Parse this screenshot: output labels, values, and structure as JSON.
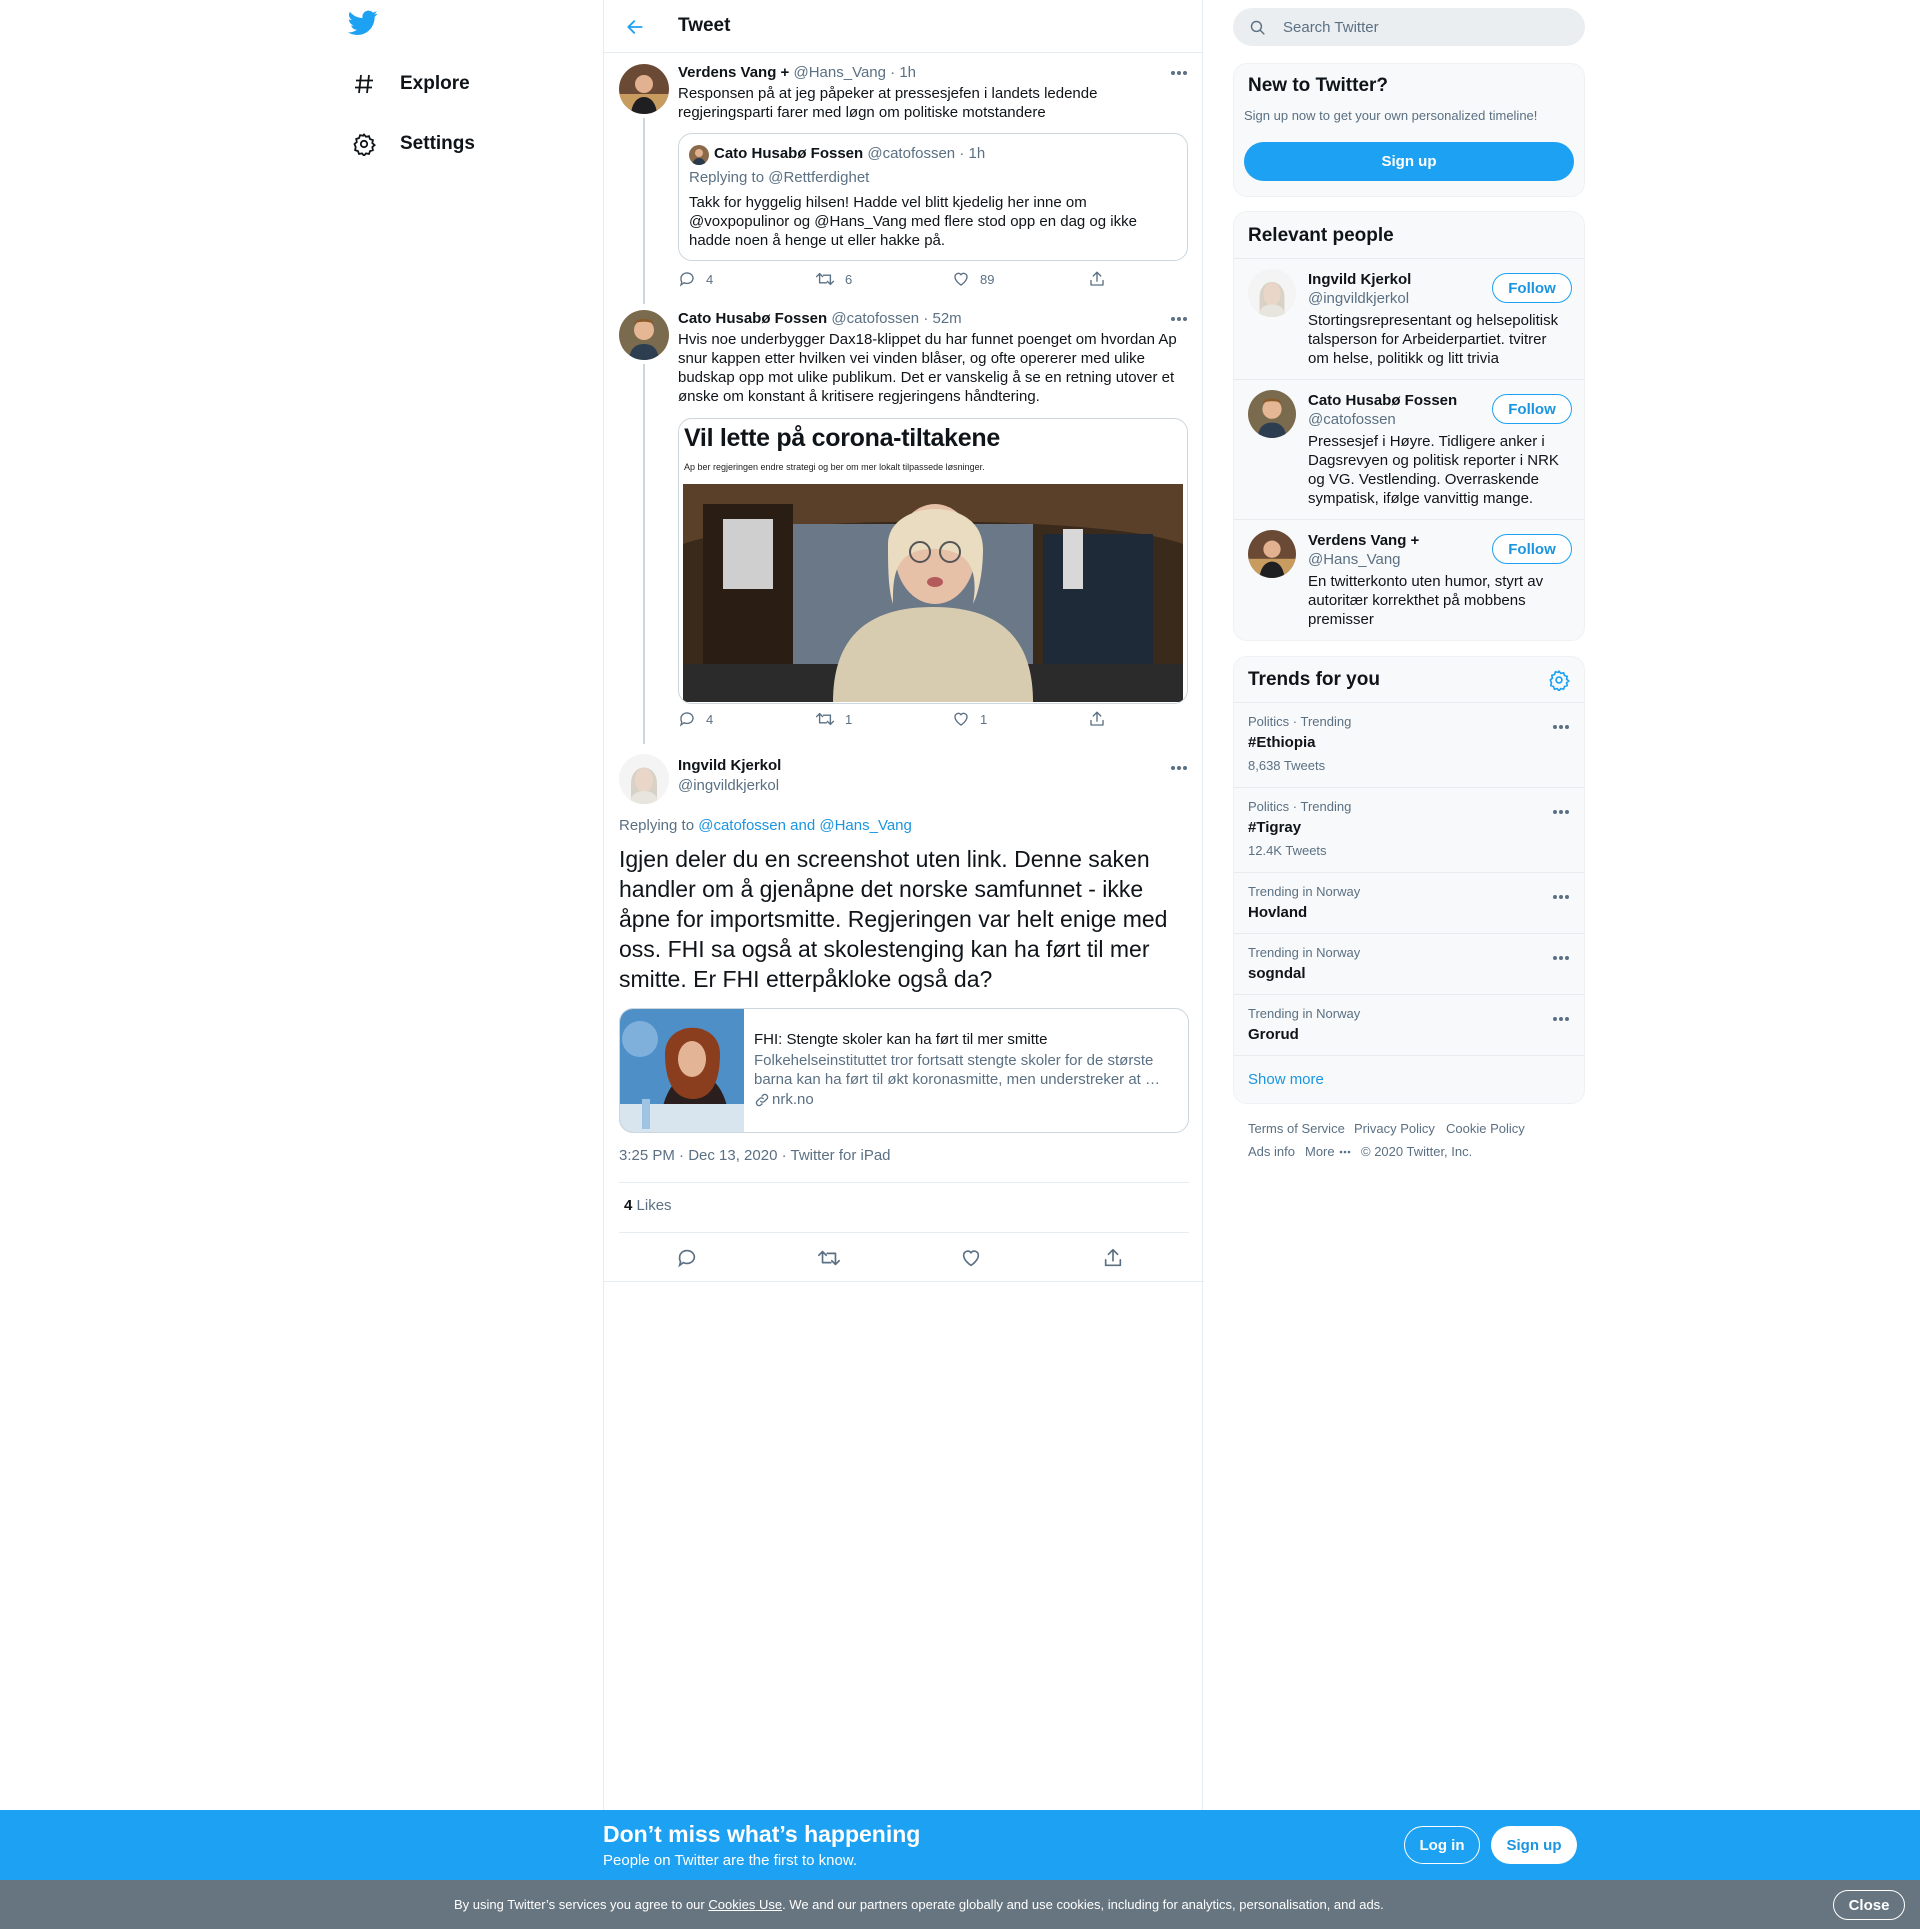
{
  "nav": {
    "logo": "twitter-bird-icon",
    "items": [
      {
        "label": "Explore",
        "icon": "hashtag-icon"
      },
      {
        "label": "Settings",
        "icon": "gear-icon"
      }
    ]
  },
  "header": {
    "title": "Tweet"
  },
  "tweets": [
    {
      "name": "Verdens Vang +",
      "handle": "@Hans_Vang",
      "time": "· 1h",
      "text": "Responsen på at jeg påpeker at pressesjefen i landets ledende regjeringsparti farer med løgn om politiske motstandere",
      "quote": {
        "name": "Cato Husabø Fossen",
        "handle": "@catofossen",
        "time": "· 1h",
        "replying": "Replying to @Rettferdighet",
        "text": "Takk for hyggelig hilsen! Hadde vel blitt kjedelig her inne om @voxpopulinor og @Hans_Vang med flere stod opp en dag og ikke hadde noen å henge ut eller hakke på."
      },
      "replies": "4",
      "retweets": "6",
      "likes": "89"
    },
    {
      "name": "Cato Husabø Fossen",
      "handle": "@catofossen",
      "time": "· 52m",
      "text": "Hvis noe underbygger Dax18-klippet du har funnet poenget om hvordan Ap snur kappen etter hvilken vei vinden blåser, og ofte opererer med ulike budskap opp mot ulike publikum. Det er vanskelig å se en retning utover et ønske om konstant å kritisere regjeringens håndtering.",
      "image": {
        "headline": "Vil lette på corona-tiltakene",
        "subline": "Ap ber regjeringen endre strategi og ber om mer lokalt tilpassede løsninger."
      },
      "replies": "4",
      "retweets": "1",
      "likes": "1"
    }
  ],
  "focus": {
    "name": "Ingvild Kjerkol",
    "handle": "@ingvildkjerkol",
    "replying_prefix": "Replying to",
    "replying_to": "@catofossen and @Hans_Vang",
    "text": "Igjen deler du en screenshot uten link. Denne saken handler om å gjenåpne det norske samfunnet - ikke åpne for importsmitte. Regjeringen var helt enige med oss. FHI sa også at skolestenging kan ha ført til mer smitte. Er FHI etterpåkloke også da?",
    "card": {
      "title": "FHI: Stengte skoler kan ha ført til mer smitte",
      "description": "Folkehelseinstituttet tror fortsatt stengte skoler for de største barna kan ha ført til økt koronasmitte, men understreker at …",
      "domain": "nrk.no"
    },
    "timestamp": "3:25 PM · Dec 13, 2020 · Twitter for iPad",
    "likes_count": "4",
    "likes_label": "Likes"
  },
  "search": {
    "placeholder": "Search Twitter"
  },
  "new_to_twitter": {
    "title": "New to Twitter?",
    "subtitle": "Sign up now to get your own personalized timeline!",
    "button": "Sign up"
  },
  "relevant": {
    "title": "Relevant people",
    "follow_label": "Follow",
    "people": [
      {
        "name": "Ingvild Kjerkol",
        "handle": "@ingvildkjerkol",
        "bio": "Stortingsrepresentant og helsepolitisk talsperson for Arbeiderpartiet. tvitrer om helse, politikk og litt trivia"
      },
      {
        "name": "Cato Husabø Fossen",
        "handle": "@catofossen",
        "bio": "Pressesjef i Høyre. Tidligere anker i Dagsrevyen og politisk reporter i NRK og VG. Vestlending. Overraskende sympatisk, ifølge vanvittig mange."
      },
      {
        "name": "Verdens Vang +",
        "handle": "@Hans_Vang",
        "bio": "En twitterkonto uten humor, styrt av autoritær korrekthet på mobbens premisser"
      }
    ]
  },
  "trends": {
    "title": "Trends for you",
    "items": [
      {
        "meta": "Politics · Trending",
        "name": "#Ethiopia",
        "count": "8,638 Tweets"
      },
      {
        "meta": "Politics · Trending",
        "name": "#Tigray",
        "count": "12.4K Tweets"
      },
      {
        "meta": "Trending in Norway",
        "name": "Hovland",
        "count": ""
      },
      {
        "meta": "Trending in Norway",
        "name": "sogndal",
        "count": ""
      },
      {
        "meta": "Trending in Norway",
        "name": "Grorud",
        "count": ""
      }
    ],
    "show_more": "Show more"
  },
  "footer": {
    "terms": "Terms of Service",
    "privacy": "Privacy Policy",
    "cookie": "Cookie Policy",
    "ads": "Ads info",
    "more": "More",
    "copyright": "© 2020 Twitter, Inc."
  },
  "banner": {
    "title": "Don’t miss what’s happening",
    "subtitle": "People on Twitter are the first to know.",
    "login": "Log in",
    "signup": "Sign up"
  },
  "cookie": {
    "before": "By using Twitter’s services you agree to our ",
    "link": "Cookies Use",
    "after": ". We and our partners operate globally and use cookies, including for analytics, personalisation, and ads.",
    "close": "Close"
  },
  "colors": {
    "accent": "#1da1f2",
    "link": "#1b95e0",
    "muted": "#5b7083",
    "cookie_bar": "#66757f"
  }
}
